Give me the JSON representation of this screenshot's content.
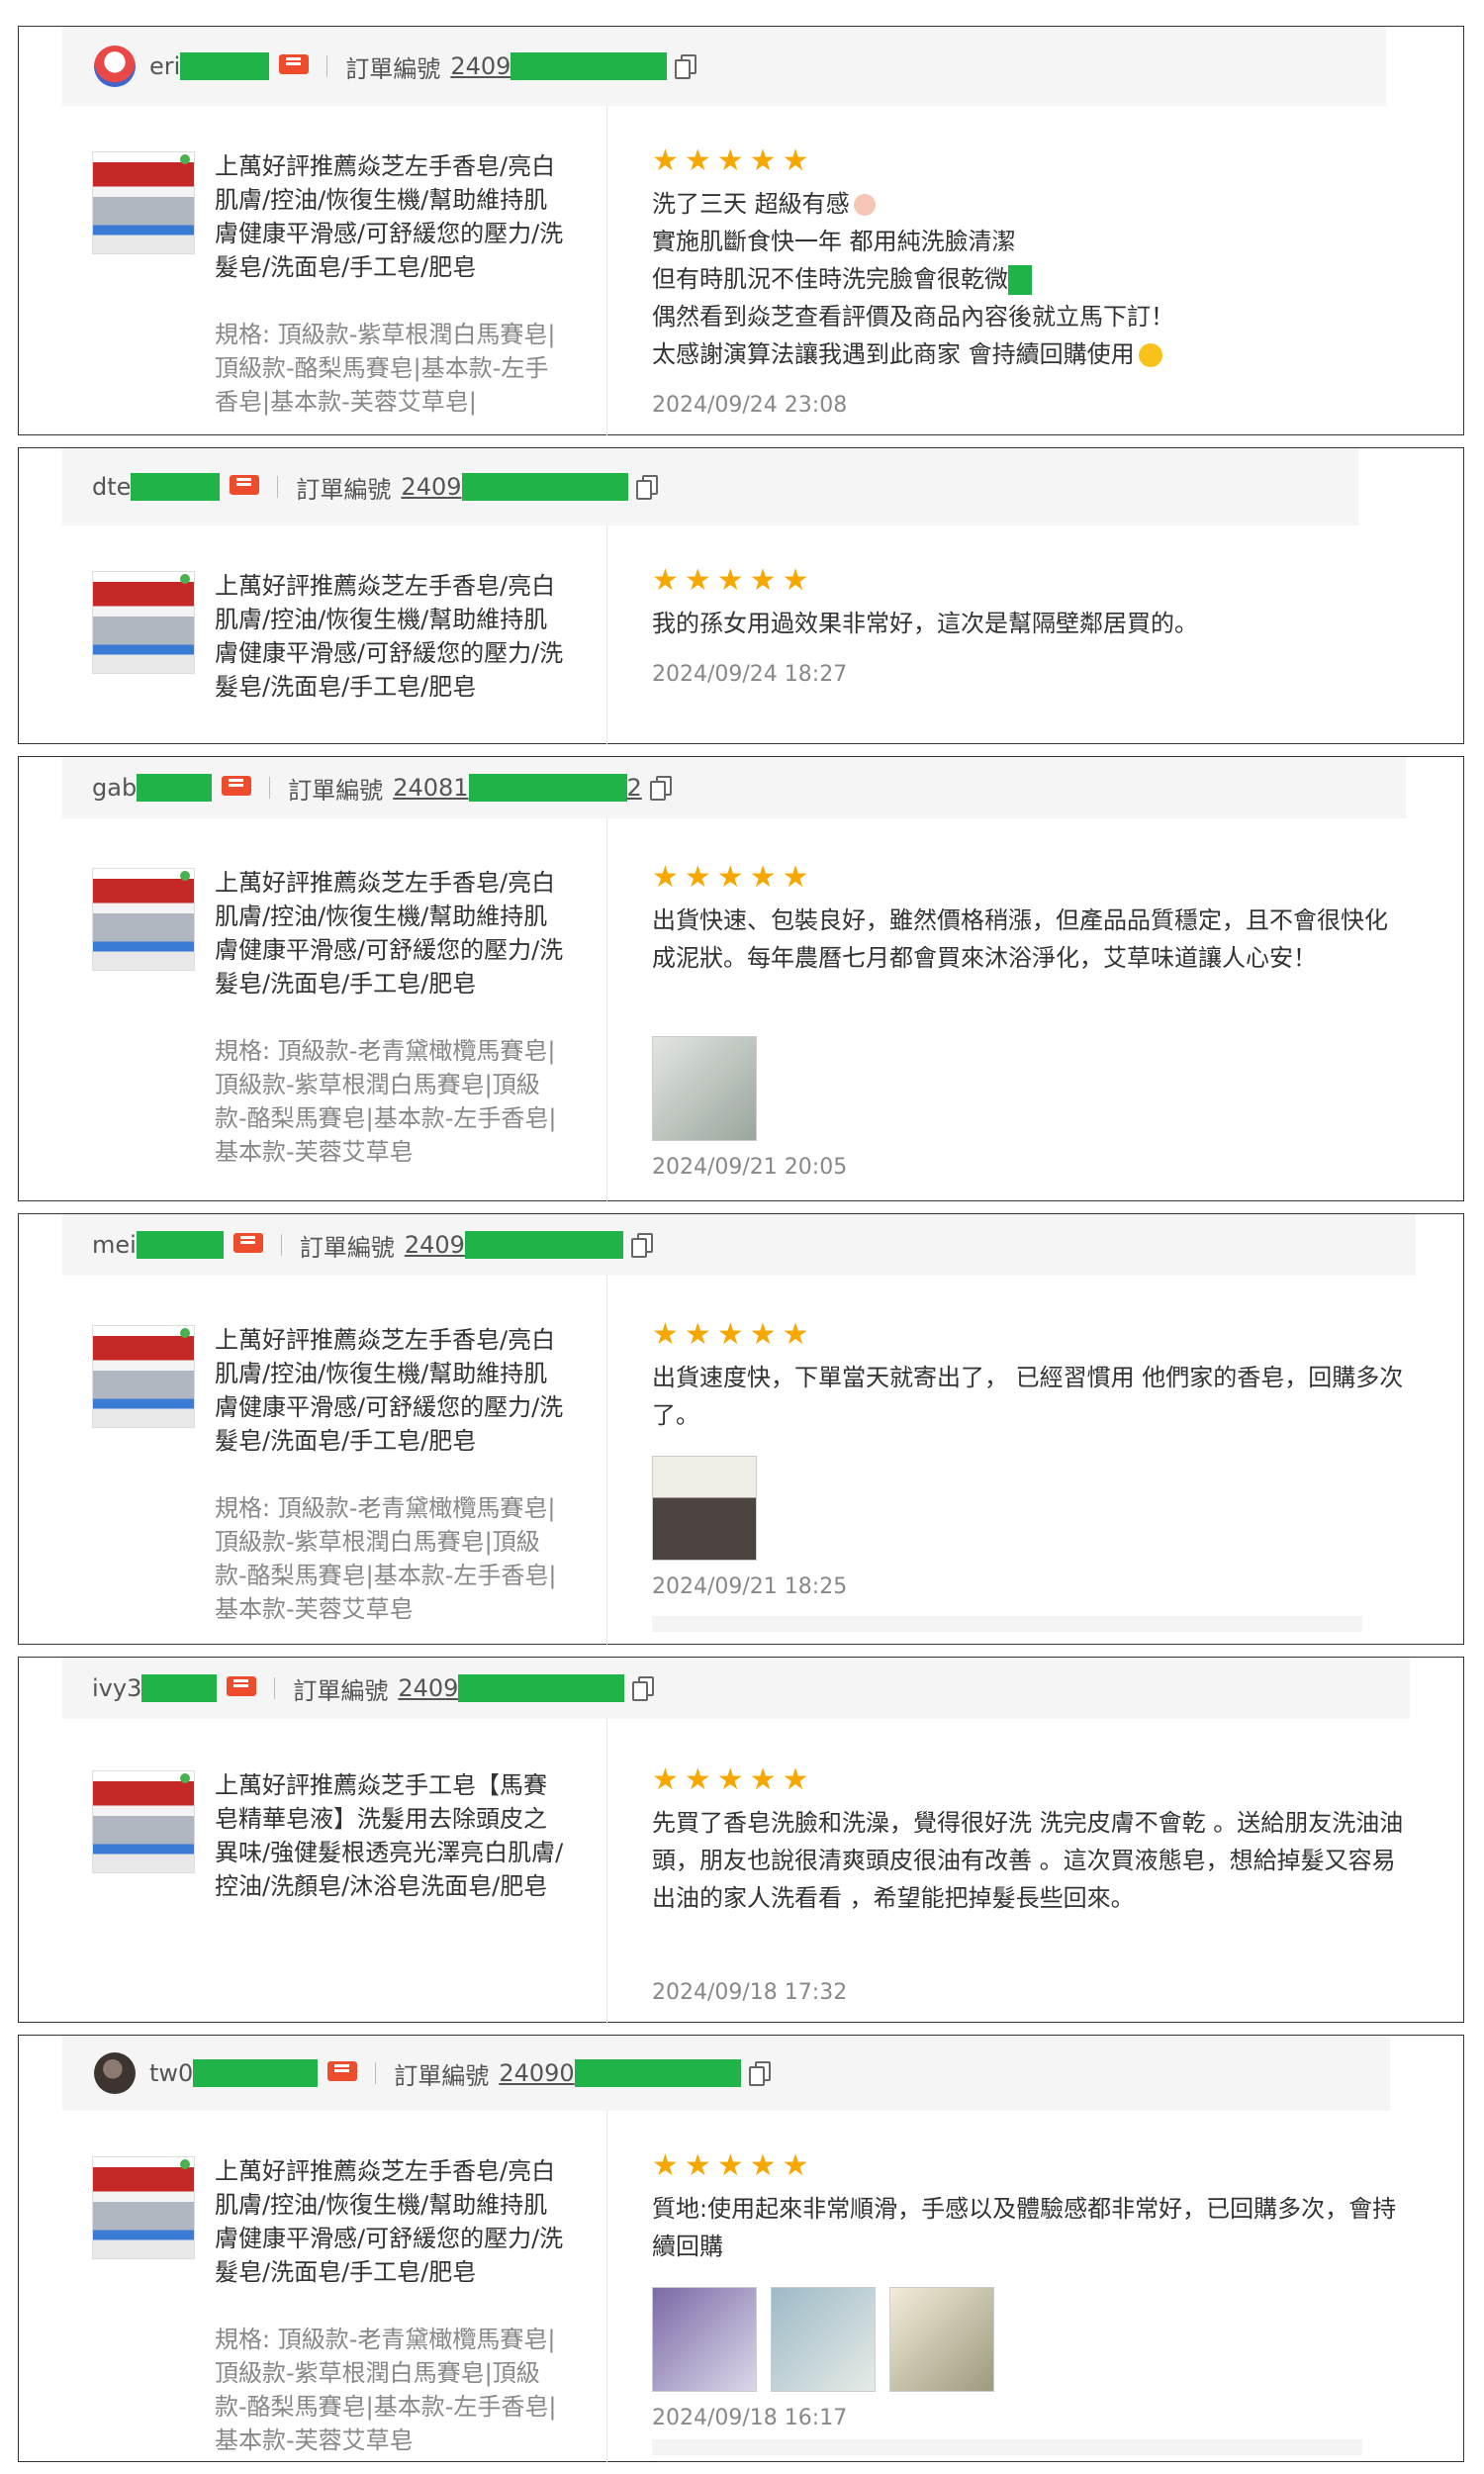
{
  "order_label": "訂單編號",
  "rating_stars": "★★★★★",
  "reviews": [
    {
      "username": "eri",
      "order_prefix": "2409",
      "avatar": "mascot-avatar",
      "product_title": "上萬好評推薦焱芝左手香皂/亮白肌膚/控油/恢復生機/幫助維持肌膚健康平滑感/可舒緩您的壓力/洗髮皂/洗面皂/手工皂/肥皂",
      "spec": "規格: 頂級款-紫草根潤白馬賽皂|頂級款-酪梨馬賽皂|基本款-左手香皂|基本款-芙蓉艾草皂|",
      "review_line1": "洗了三天 超級有感",
      "review_line2": "實施肌斷食快一年 都用純洗臉清潔",
      "review_line3": "但有時肌況不佳時洗完臉會很乾微",
      "review_line4": "偶然看到焱芝查看評價及商品內容後就立馬下訂！",
      "review_line5": "太感謝演算法讓我遇到此商家 會持續回購使用",
      "date": "2024/09/24 23:08"
    },
    {
      "username": "dte",
      "order_prefix": "2409",
      "product_title": "上萬好評推薦焱芝左手香皂/亮白肌膚/控油/恢復生機/幫助維持肌膚健康平滑感/可舒緩您的壓力/洗髮皂/洗面皂/手工皂/肥皂",
      "review": "我的孫女用過效果非常好，這次是幫隔壁鄰居買的。",
      "date": "2024/09/24 18:27"
    },
    {
      "username": "gab",
      "order_prefix": "24081",
      "order_suffix": "2",
      "product_title": "上萬好評推薦焱芝左手香皂/亮白肌膚/控油/恢復生機/幫助維持肌膚健康平滑感/可舒緩您的壓力/洗髮皂/洗面皂/手工皂/肥皂",
      "spec": "規格: 頂級款-老青黛橄欖馬賽皂|頂級款-紫草根潤白馬賽皂|頂級款-酪梨馬賽皂|基本款-左手香皂|基本款-芙蓉艾草皂",
      "review": "出貨快速、包裝良好，雖然價格稍漲，但產品品質穩定，且不會很快化成泥狀。每年農曆七月都會買來沐浴淨化，艾草味道讓人心安！",
      "date": "2024/09/21 20:05"
    },
    {
      "username": "mei",
      "order_prefix": "2409",
      "product_title": "上萬好評推薦焱芝左手香皂/亮白肌膚/控油/恢復生機/幫助維持肌膚健康平滑感/可舒緩您的壓力/洗髮皂/洗面皂/手工皂/肥皂",
      "spec": "規格: 頂級款-老青黛橄欖馬賽皂|頂級款-紫草根潤白馬賽皂|頂級款-酪梨馬賽皂|基本款-左手香皂|基本款-芙蓉艾草皂",
      "review": "出貨速度快，下單當天就寄出了， 已經習慣用 他們家的香皂，回購多次了。",
      "date": "2024/09/21 18:25"
    },
    {
      "username": "ivy3",
      "order_prefix": "2409",
      "product_title": "上萬好評推薦焱芝手工皂【馬賽皂精華皂液】洗髮用去除頭皮之異味/強健髮根透亮光澤亮白肌膚/控油/洗顏皂/沐浴皂洗面皂/肥皂",
      "review": "先買了香皂洗臉和洗澡，覺得很好洗 洗完皮膚不會乾 。送給朋友洗油油頭，朋友也說很清爽頭皮很油有改善 。這次買液態皂，想給掉髮又容易出油的家人洗看看 ，希望能把掉髮長些回來。",
      "date": "2024/09/18 17:32"
    },
    {
      "username": "tw0",
      "order_prefix": "24090",
      "avatar": "photo-avatar",
      "product_title": "上萬好評推薦焱芝左手香皂/亮白肌膚/控油/恢復生機/幫助維持肌膚健康平滑感/可舒緩您的壓力/洗髮皂/洗面皂/手工皂/肥皂",
      "spec": "規格: 頂級款-老青黛橄欖馬賽皂|頂級款-紫草根潤白馬賽皂|頂級款-酪梨馬賽皂|基本款-左手香皂|基本款-芙蓉艾草皂",
      "review": "質地:使用起來非常順滑，手感以及體驗感都非常好，已回購多次，會持續回購",
      "date": "2024/09/18 16:17"
    }
  ]
}
